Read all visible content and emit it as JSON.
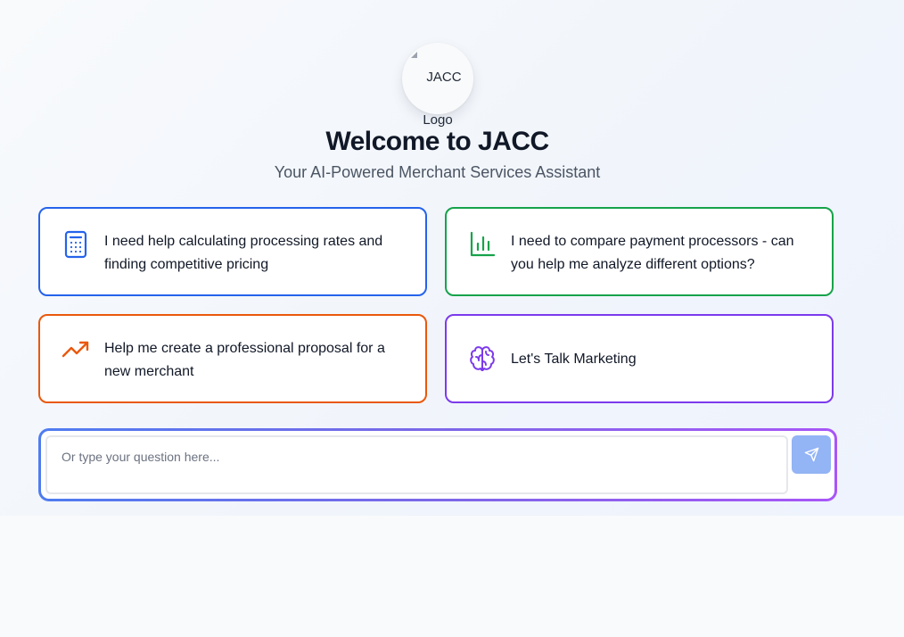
{
  "logo": {
    "alt_line1": "JACC",
    "alt_line2": "Logo"
  },
  "header": {
    "title": "Welcome to JACC",
    "subtitle": "Your AI-Powered Merchant Services Assistant"
  },
  "cards": [
    {
      "label": "I need help calculating processing rates and finding competitive pricing",
      "icon": "calculator-icon",
      "color": "#2563eb"
    },
    {
      "label": "I need to compare payment processors - can you help me analyze different options?",
      "icon": "bar-chart-icon",
      "color": "#16a34a"
    },
    {
      "label": "Help me create a professional proposal for a new merchant",
      "icon": "trending-up-icon",
      "color": "#ea580c"
    },
    {
      "label": "Let's Talk Marketing",
      "icon": "brain-icon",
      "color": "#7c3aed"
    }
  ],
  "chat_input": {
    "placeholder": "Or type your question here...",
    "value": "",
    "send_icon": "send-icon",
    "send_color": "#93b4f5"
  },
  "colors": {
    "gradient_start": "#4f7cf0",
    "gradient_end": "#a855f7"
  }
}
